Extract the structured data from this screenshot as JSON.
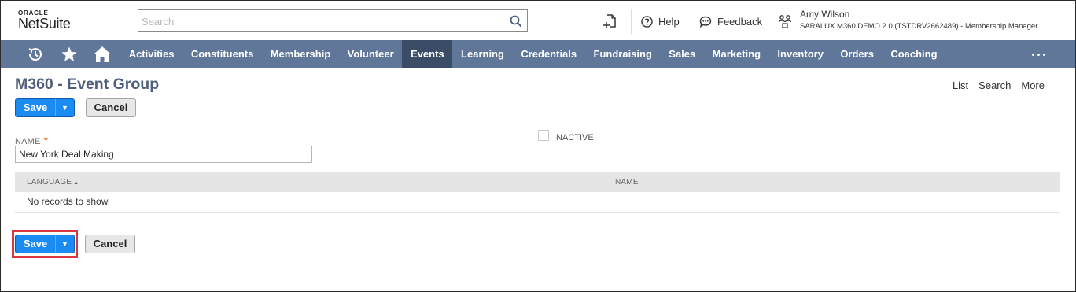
{
  "header": {
    "logo_top": "ORACLE",
    "logo_main": "NetSuite",
    "search": {
      "placeholder": "Search",
      "value": ""
    },
    "help_label": "Help",
    "feedback_label": "Feedback",
    "user": {
      "name": "Amy Wilson",
      "role": "SARALUX M360 DEMO 2.0 (TSTDRV2662489) - Membership Manager"
    }
  },
  "nav": {
    "items": [
      "Activities",
      "Constituents",
      "Membership",
      "Volunteer",
      "Events",
      "Learning",
      "Credentials",
      "Fundraising",
      "Sales",
      "Marketing",
      "Inventory",
      "Orders",
      "Coaching"
    ],
    "active": "Events"
  },
  "page": {
    "title": "M360 - Event Group",
    "links": [
      "List",
      "Search",
      "More"
    ]
  },
  "buttons": {
    "save": "Save",
    "cancel": "Cancel",
    "caret": "▼"
  },
  "form": {
    "name_label": "NAME",
    "required_mark": "*",
    "name_value": "New York Deal Making",
    "inactive_label": "INACTIVE",
    "inactive_checked": false
  },
  "table": {
    "columns": [
      "LANGUAGE",
      "NAME"
    ],
    "sort_indicator": "▲",
    "empty_text": "No records to show."
  },
  "colors": {
    "nav_bg": "#607799",
    "nav_active": "#3a4c66",
    "title": "#4d5f79",
    "save_bg": "#1a8bf0",
    "highlight": "#d9363e"
  }
}
